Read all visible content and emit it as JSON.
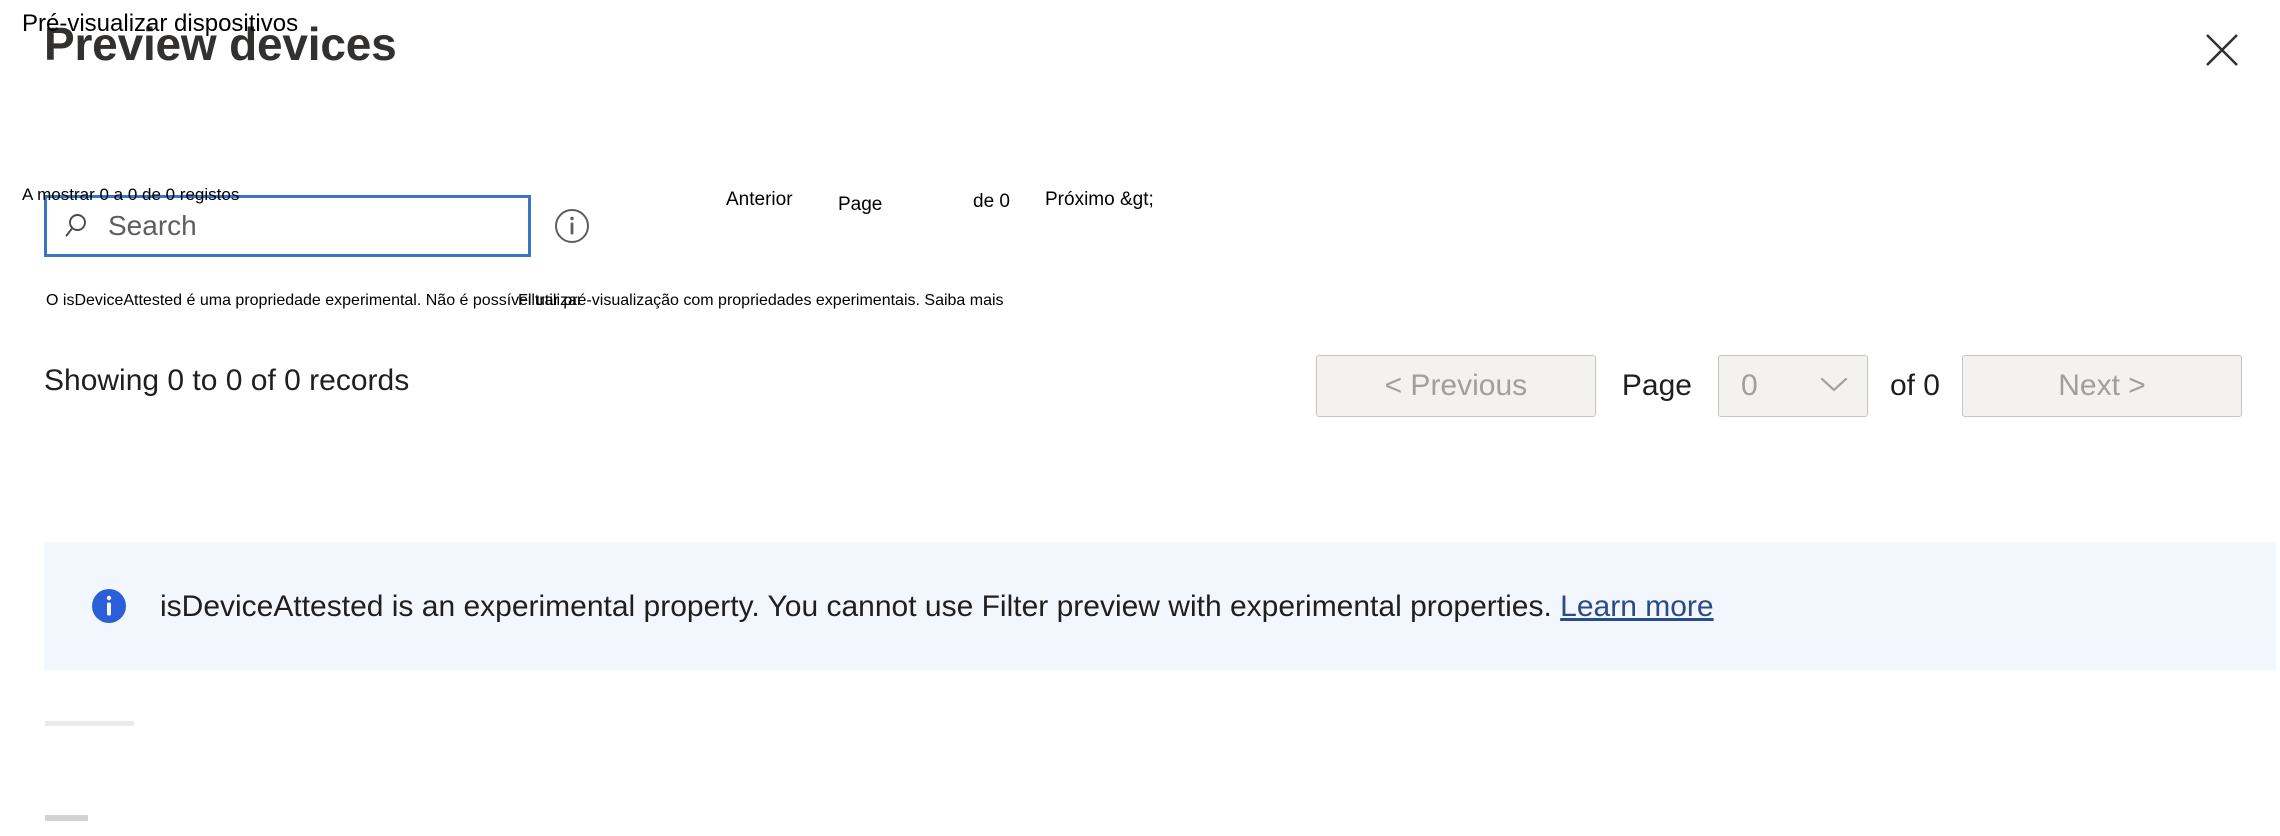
{
  "header": {
    "title": "Preview devices",
    "close_icon": "close-icon"
  },
  "search": {
    "value": "",
    "placeholder": "Search",
    "search_icon": "search-icon",
    "info_icon": "info-circle-icon"
  },
  "records": {
    "summary": "Showing 0 to 0 of 0 records"
  },
  "pagination": {
    "previous_label": "< Previous",
    "page_label": "Page",
    "page_value": "0",
    "page_total_label": "of 0",
    "next_label": "Next >",
    "chevron_icon": "chevron-down-icon"
  },
  "banner": {
    "info_icon": "info-filled-icon",
    "text": "isDeviceAttested is an experimental property. You cannot use Filter preview with experimental properties.",
    "link_label": "Learn more",
    "background_color": "#f2f6fd",
    "icon_color": "#2b5fd9",
    "link_color": "#2b4a8b"
  },
  "translation_overlay": {
    "title": "Pré-visualizar dispositivos",
    "records": "A mostrar 0 a 0 de 0 registos",
    "previous": "Anterior",
    "page": "Page",
    "page_total": "de 0",
    "next": "Próximo &gt;",
    "experimental_line_1": "O isDeviceAttested é uma propriedade experimental. Não é possível utilizar",
    "experimental_line_2": "Filtrar pré-visualização com propriedades experimentais. Saiba mais"
  },
  "colors": {
    "accent": "#3a74c4",
    "disabled_text": "#a19f9d",
    "button_bg": "#f3f2f1",
    "button_border": "#c8c6c4",
    "title": "#323130"
  }
}
